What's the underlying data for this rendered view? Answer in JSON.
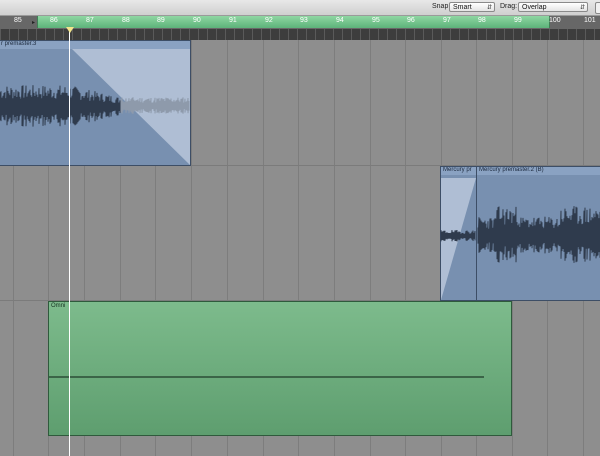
{
  "toolbar": {
    "snap_label": "Snap:",
    "snap_value": "Smart",
    "drag_label": "Drag:",
    "drag_value": "Overlap"
  },
  "ruler": {
    "bars": [
      "85",
      "86",
      "87",
      "88",
      "89",
      "90",
      "91",
      "92",
      "93",
      "94",
      "95",
      "96",
      "97",
      "98",
      "99",
      "100",
      "101"
    ],
    "cycle_color": "#6cc38a"
  },
  "regions": {
    "audio_1_name": "r premaster.3",
    "audio_2_name": "Mercury pr",
    "audio_3_name": "Mercury premaster.2 (B)",
    "midi_1_name": "Omni"
  },
  "colors": {
    "audio_region": "#7890b0",
    "midi_region": "#6aab7b",
    "waveform": "#2f3b4d",
    "playhead": "#ffffff"
  }
}
